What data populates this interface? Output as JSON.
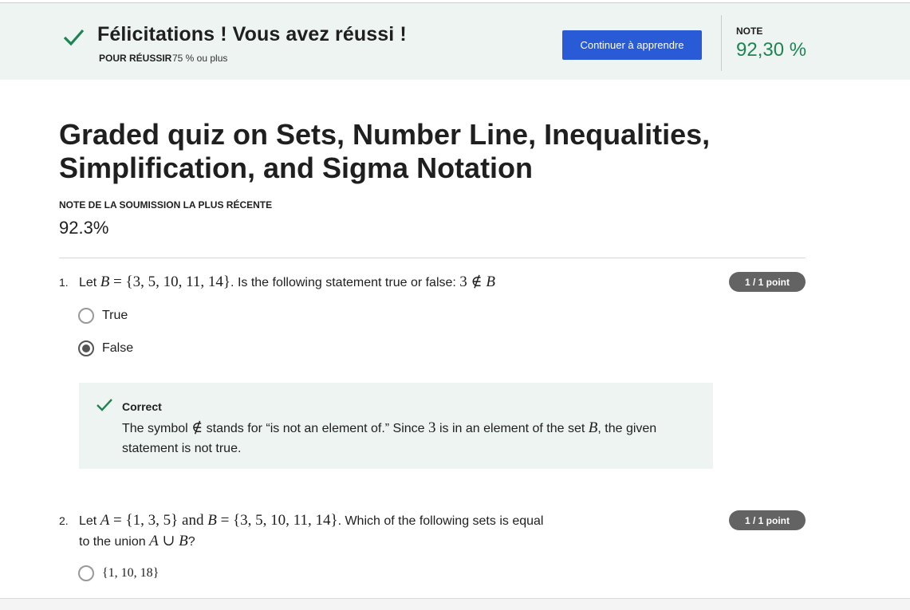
{
  "banner": {
    "title": "Félicitations ! Vous avez réussi !",
    "pass_label": "POUR RÉUSSIR",
    "pass_value": "75 % ou plus",
    "continue_label": "Continuer à apprendre",
    "grade_label": "NOTE",
    "grade_value": "92,30 %",
    "accent_color": "#1f8354",
    "button_color": "#2a5bd7"
  },
  "quiz": {
    "title": "Graded quiz on Sets, Number Line, Inequalities, Simplification, and Sigma Notation",
    "recent_label": "NOTE DE LA SOUMISSION LA PLUS RÉCENTE",
    "recent_value": "92.3%"
  },
  "questions": [
    {
      "number": "1.",
      "text_a": "Let ",
      "math_b": "B",
      "math_eq": " = {3, 5, 10, 11, 14}",
      "text_b": ". Is the following statement true or false: ",
      "math_stmt": "3 ∉ ",
      "math_stmt_b": "B",
      "points": "1 / 1 point",
      "options": [
        {
          "label": "True",
          "selected": false
        },
        {
          "label": "False",
          "selected": true
        }
      ],
      "feedback": {
        "title": "Correct",
        "text_1": "The symbol ",
        "sym": "∉",
        "text_2": " stands for “is not an element of.” Since ",
        "num": "3",
        "text_3": " is in an element of the set ",
        "setname": "B",
        "text_4": ", the given statement is not true."
      }
    },
    {
      "number": "2.",
      "text_a": "Let ",
      "math_a": "A",
      "math_a_eq": " = {1, 3, 5}",
      "math_and": " and ",
      "math_b": "B",
      "math_b_eq": " = {3, 5, 10, 11, 14}",
      "text_b": ". Which of the following sets is equal",
      "text_line2": "to the union ",
      "math_union_a": "A",
      "math_union": " ∪ ",
      "math_union_b": "B",
      "text_end": "?",
      "points": "1 / 1 point",
      "options": [
        {
          "label": "{1, 10, 18}",
          "selected": false
        }
      ]
    }
  ]
}
